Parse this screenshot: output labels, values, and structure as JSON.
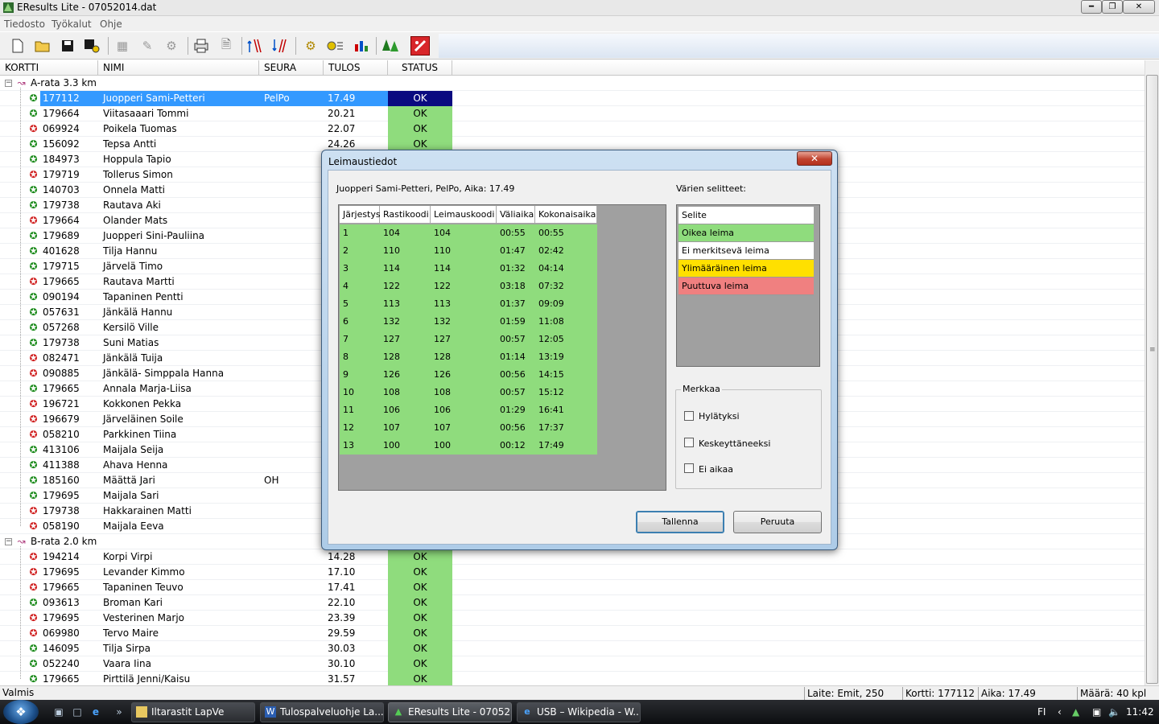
{
  "window": {
    "title": "EResults Lite - 07052014.dat"
  },
  "menu": [
    "Tiedosto",
    "Työkalut",
    "Ohje"
  ],
  "toolbar_icons": [
    "new-file-icon",
    "open-folder-icon",
    "save-icon",
    "save-as-icon",
    "readout-icon",
    "edit-icon",
    "settings-icon",
    "print-icon",
    "print-preview-icon",
    "sort-icon",
    "sort-alt-icon",
    "gear-icon",
    "reader-icon",
    "chart-icon",
    "trees-icon",
    "exit-icon"
  ],
  "columns": [
    "KORTTI",
    "NIMI",
    "SEURA",
    "TULOS",
    "STATUS"
  ],
  "groups": [
    {
      "name": "A-rata 3.3 km",
      "rows": [
        {
          "card": "177112",
          "name": "Juopperi Sami-Petteri",
          "club": "PelPo",
          "result": "17.49",
          "status": "OK",
          "icon": "green",
          "selected": true
        },
        {
          "card": "179664",
          "name": "Viitasaaari Tommi",
          "club": "",
          "result": "20.21",
          "status": "OK",
          "icon": "green"
        },
        {
          "card": "069924",
          "name": "Poikela Tuomas",
          "club": "",
          "result": "22.07",
          "status": "OK",
          "icon": "red"
        },
        {
          "card": "156092",
          "name": "Tepsa Antti",
          "club": "",
          "result": "24.26",
          "status": "OK",
          "icon": "green"
        },
        {
          "card": "184973",
          "name": "Hoppula Tapio",
          "club": "",
          "result": "",
          "status": "",
          "icon": "green"
        },
        {
          "card": "179719",
          "name": "Tollerus Simon",
          "club": "",
          "result": "",
          "status": "",
          "icon": "red"
        },
        {
          "card": "140703",
          "name": "Onnela Matti",
          "club": "",
          "result": "",
          "status": "",
          "icon": "green"
        },
        {
          "card": "179738",
          "name": "Rautava Aki",
          "club": "",
          "result": "",
          "status": "",
          "icon": "green"
        },
        {
          "card": "179664",
          "name": "Olander Mats",
          "club": "",
          "result": "",
          "status": "",
          "icon": "red"
        },
        {
          "card": "179689",
          "name": "Juopperi Sini-Pauliina",
          "club": "",
          "result": "",
          "status": "",
          "icon": "green"
        },
        {
          "card": "401628",
          "name": "Tilja Hannu",
          "club": "",
          "result": "",
          "status": "",
          "icon": "green"
        },
        {
          "card": "179715",
          "name": "Järvelä Timo",
          "club": "",
          "result": "",
          "status": "",
          "icon": "green"
        },
        {
          "card": "179665",
          "name": "Rautava Martti",
          "club": "",
          "result": "",
          "status": "",
          "icon": "red"
        },
        {
          "card": "090194",
          "name": "Tapaninen Pentti",
          "club": "",
          "result": "",
          "status": "",
          "icon": "green"
        },
        {
          "card": "057631",
          "name": "Jänkälä Hannu",
          "club": "",
          "result": "",
          "status": "",
          "icon": "green"
        },
        {
          "card": "057268",
          "name": "Kersilö Ville",
          "club": "",
          "result": "",
          "status": "",
          "icon": "green"
        },
        {
          "card": "179738",
          "name": "Suni Matias",
          "club": "",
          "result": "",
          "status": "",
          "icon": "green"
        },
        {
          "card": "082471",
          "name": "Jänkälä Tuija",
          "club": "",
          "result": "",
          "status": "",
          "icon": "red"
        },
        {
          "card": "090885",
          "name": "Jänkälä- Simppala Hanna",
          "club": "",
          "result": "",
          "status": "",
          "icon": "red"
        },
        {
          "card": "179665",
          "name": "Annala Marja-Liisa",
          "club": "",
          "result": "",
          "status": "",
          "icon": "green"
        },
        {
          "card": "196721",
          "name": "Kokkonen Pekka",
          "club": "",
          "result": "",
          "status": "",
          "icon": "red"
        },
        {
          "card": "196679",
          "name": "Järveläinen Soile",
          "club": "",
          "result": "",
          "status": "",
          "icon": "red"
        },
        {
          "card": "058210",
          "name": "Parkkinen Tiina",
          "club": "",
          "result": "",
          "status": "",
          "icon": "red"
        },
        {
          "card": "413106",
          "name": "Maijala Seija",
          "club": "",
          "result": "",
          "status": "",
          "icon": "green"
        },
        {
          "card": "411388",
          "name": "Ahava Henna",
          "club": "",
          "result": "",
          "status": "",
          "icon": "green"
        },
        {
          "card": "185160",
          "name": "Määttä Jari",
          "club": "OH",
          "result": "",
          "status": "",
          "icon": "green"
        },
        {
          "card": "179695",
          "name": "Maijala Sari",
          "club": "",
          "result": "",
          "status": "",
          "icon": "green"
        },
        {
          "card": "179738",
          "name": "Hakkarainen Matti",
          "club": "",
          "result": "",
          "status": "",
          "icon": "red"
        },
        {
          "card": "058190",
          "name": "Maijala Eeva",
          "club": "",
          "result": "",
          "status": "",
          "icon": "red"
        }
      ]
    },
    {
      "name": "B-rata 2.0 km",
      "rows": [
        {
          "card": "194214",
          "name": "Korpi Virpi",
          "club": "",
          "result": "14.28",
          "status": "OK",
          "icon": "red"
        },
        {
          "card": "179695",
          "name": "Levander Kimmo",
          "club": "",
          "result": "17.10",
          "status": "OK",
          "icon": "red"
        },
        {
          "card": "179665",
          "name": "Tapaninen Teuvo",
          "club": "",
          "result": "17.41",
          "status": "OK",
          "icon": "red"
        },
        {
          "card": "093613",
          "name": "Broman Kari",
          "club": "",
          "result": "22.10",
          "status": "OK",
          "icon": "green"
        },
        {
          "card": "179695",
          "name": "Vesterinen Marjo",
          "club": "",
          "result": "23.39",
          "status": "OK",
          "icon": "red"
        },
        {
          "card": "069980",
          "name": "Tervo Maire",
          "club": "",
          "result": "29.59",
          "status": "OK",
          "icon": "red"
        },
        {
          "card": "146095",
          "name": "Tilja Sirpa",
          "club": "",
          "result": "30.03",
          "status": "OK",
          "icon": "green"
        },
        {
          "card": "052240",
          "name": "Vaara Iina",
          "club": "",
          "result": "30.10",
          "status": "OK",
          "icon": "green"
        },
        {
          "card": "179665",
          "name": "Pirttilä Jenni/Kaisu",
          "club": "",
          "result": "31.57",
          "status": "OK",
          "icon": "green"
        }
      ]
    }
  ],
  "dialog": {
    "title": "Leimaustiedot",
    "runner_info": "Juopperi Sami-Petteri, PelPo,  Aika: 17.49",
    "legend_title": "Värien selitteet:",
    "columns": [
      "Järjestys",
      "Rastikoodi",
      "Leimauskoodi",
      "Väliaika",
      "Kokonaisaika"
    ],
    "punches": [
      [
        "1",
        "104",
        "104",
        "00:55",
        "00:55"
      ],
      [
        "2",
        "110",
        "110",
        "01:47",
        "02:42"
      ],
      [
        "3",
        "114",
        "114",
        "01:32",
        "04:14"
      ],
      [
        "4",
        "122",
        "122",
        "03:18",
        "07:32"
      ],
      [
        "5",
        "113",
        "113",
        "01:37",
        "09:09"
      ],
      [
        "6",
        "132",
        "132",
        "01:59",
        "11:08"
      ],
      [
        "7",
        "127",
        "127",
        "00:57",
        "12:05"
      ],
      [
        "8",
        "128",
        "128",
        "01:14",
        "13:19"
      ],
      [
        "9",
        "126",
        "126",
        "00:56",
        "14:15"
      ],
      [
        "10",
        "108",
        "108",
        "00:57",
        "15:12"
      ],
      [
        "11",
        "106",
        "106",
        "01:29",
        "16:41"
      ],
      [
        "12",
        "107",
        "107",
        "00:56",
        "17:37"
      ],
      [
        "13",
        "100",
        "100",
        "00:12",
        "17:49"
      ]
    ],
    "legend_header": "Selite",
    "legend": [
      {
        "label": "Oikea leima",
        "color": "#8fdc7d"
      },
      {
        "label": "Ei merkitsevä leima",
        "color": "#ffffff"
      },
      {
        "label": "Ylimääräinen leima",
        "color": "#ffe000"
      },
      {
        "label": "Puuttuva leima",
        "color": "#f08080"
      }
    ],
    "mark_group": "Merkkaa",
    "checkboxes": [
      "Hylätyksi",
      "Keskeyttäneeksi",
      "Ei aikaa"
    ],
    "save_label": "Tallenna",
    "cancel_label": "Peruuta"
  },
  "statusbar": {
    "status": "Valmis",
    "reader": "Laite: Emit, 250",
    "card": "Kortti: 177112",
    "time": "Aika: 17.49",
    "count": "Määrä: 40 kpl"
  },
  "taskbar": {
    "tasks": [
      "Iltarastit LapVe",
      "Tulospalveluohje La...",
      "EResults Lite - 07052...",
      "USB – Wikipedia - W..."
    ],
    "lang": "FI",
    "clock": "11:42"
  },
  "colors": {
    "ok_green": "#8fdc7d",
    "selection": "#3399ff",
    "selected_status": "#0a0a80"
  }
}
